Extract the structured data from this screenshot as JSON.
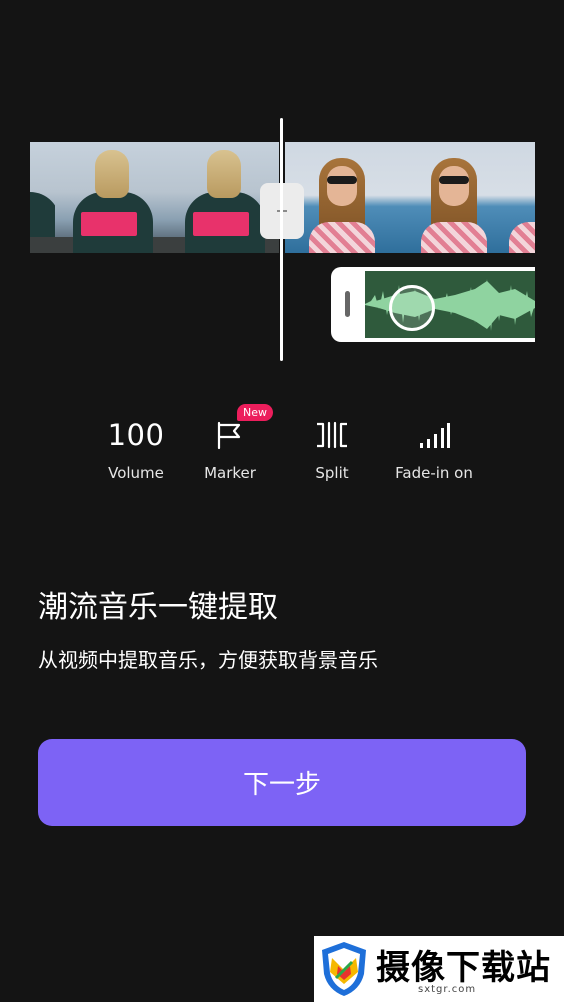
{
  "tools": {
    "volume": {
      "value": "100",
      "label": "Volume"
    },
    "marker": {
      "label": "Marker",
      "badge": "New",
      "icon": "flag-icon"
    },
    "split": {
      "label": "Split",
      "icon": "split-icon"
    },
    "fade": {
      "label": "Fade-in on",
      "icon": "signal-bars-icon"
    }
  },
  "feature": {
    "title": "潮流音乐一键提取",
    "subtitle": "从视频中提取音乐，方便获取背景音乐"
  },
  "next_button": {
    "label": "下一步"
  },
  "watermark": {
    "text": "摄像下载站",
    "url": "sxtgr.com"
  },
  "colors": {
    "background": "#141414",
    "accent": "#7d63f5",
    "badge": "#ec1e5c",
    "waveform": "#8fd3a0"
  }
}
